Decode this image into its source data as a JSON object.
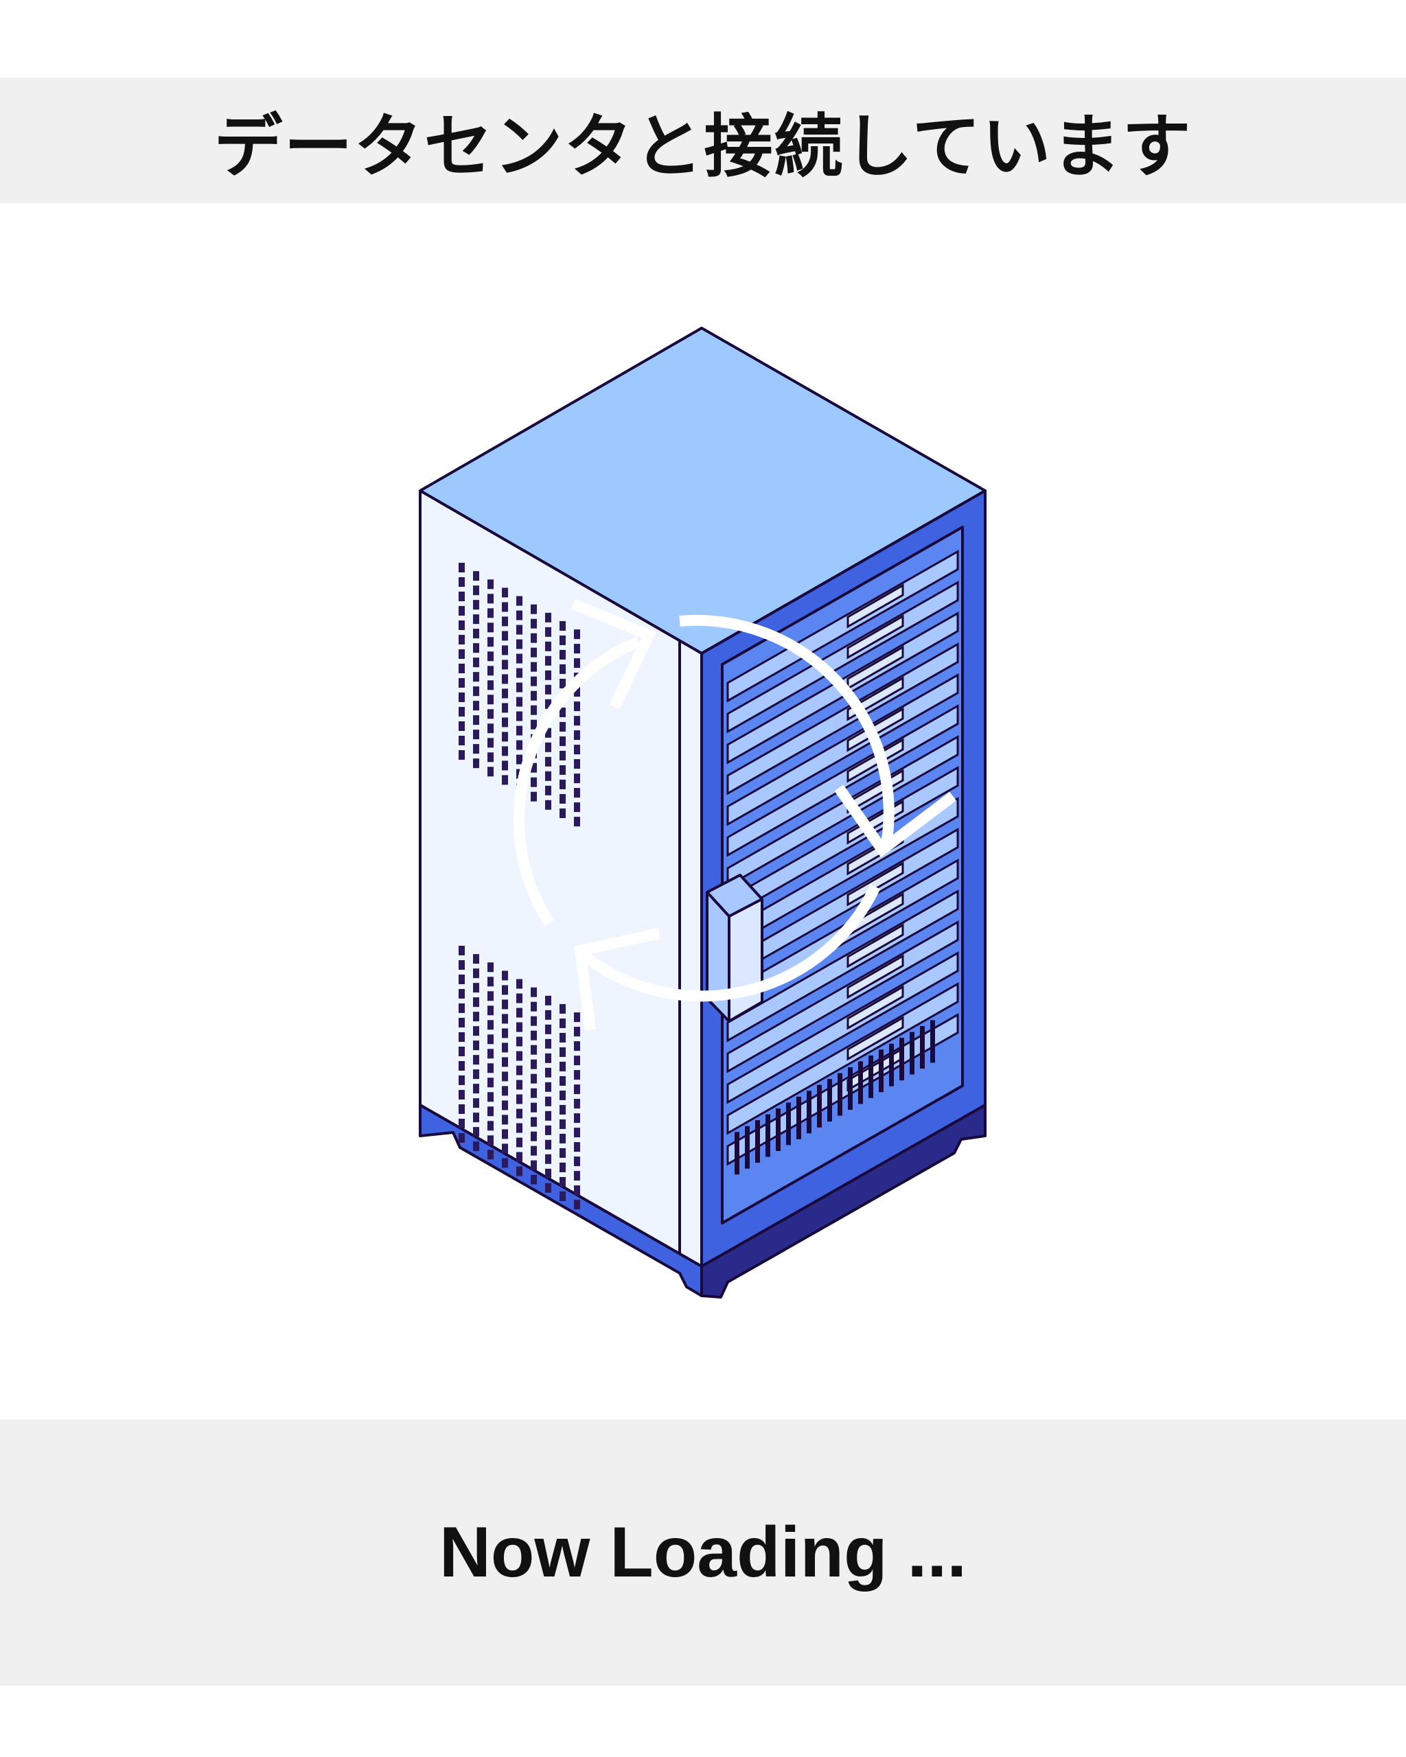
{
  "header": {
    "title": "データセンタと接続しています"
  },
  "footer": {
    "status": "Now Loading ..."
  },
  "illustration": {
    "subject": "server-rack-icon",
    "overlay": "refresh-arrows-icon"
  },
  "colors": {
    "banner_bg": "#f0f0f0",
    "outline": "#1a0a3c",
    "rack_top": "#9ec9ff",
    "rack_side": "#eef5ff",
    "rack_front": "#5b86f2",
    "rack_frame": "#3f63e0",
    "server_face": "#a9c8ff",
    "arrows": "#ffffff"
  }
}
